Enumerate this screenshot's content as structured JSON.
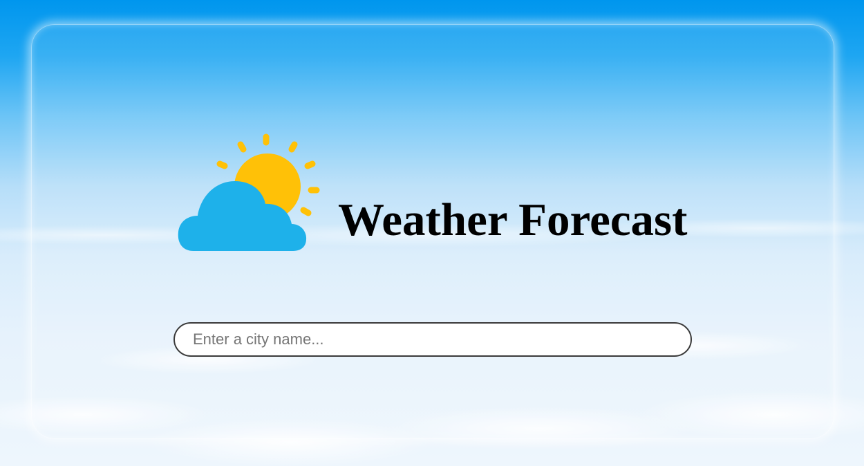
{
  "header": {
    "title": "Weather Forecast",
    "logo_icon": "sun-behind-cloud-icon"
  },
  "search": {
    "value": "",
    "placeholder": "Enter a city name..."
  },
  "colors": {
    "sun": "#FFC107",
    "cloud": "#1EB1EA",
    "sky_top": "#0096EE",
    "title_text": "#000000",
    "input_border": "#3A3A3A"
  }
}
